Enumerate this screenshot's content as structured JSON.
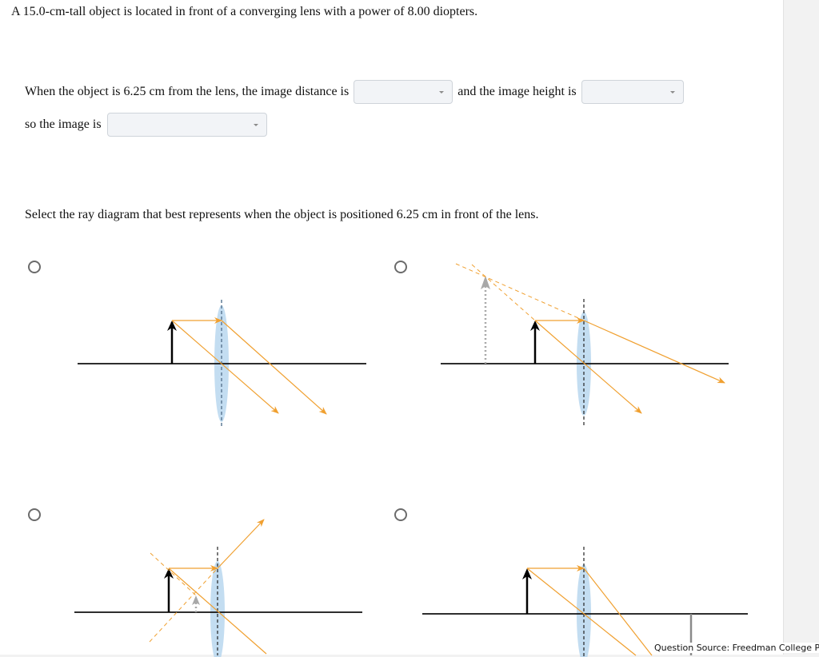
{
  "question": {
    "intro": "A 15.0-cm-tall object is located in front of a converging lens with a power of 8.00 diopters.",
    "line1_prefix": "When the object is 6.25 cm from the lens, the image distance is",
    "line1_middle": "and the image height is",
    "line2_prefix": "so the image is",
    "dropdowns": {
      "image_distance": {
        "selected": ""
      },
      "image_height": {
        "selected": ""
      },
      "image_type": {
        "selected": ""
      }
    },
    "prompt": "Select the ray diagram that best represents when the object is positioned 6.25 cm in front of the lens."
  },
  "options": [
    {
      "id": "A",
      "description": "Rays diverge after lens, no image formed (parallel refracted rays)",
      "selected": false
    },
    {
      "id": "B",
      "description": "Virtual upright enlarged image on same side as object (dashed extensions, gray dotted image arrow)",
      "selected": false
    },
    {
      "id": "C",
      "description": "Small virtual upright image between object and lens",
      "selected": false
    },
    {
      "id": "D",
      "description": "Real inverted image on far side of lens",
      "selected": false
    }
  ],
  "footer": {
    "source": "Question Source: Freedman College Phys"
  },
  "colors": {
    "ray": "#f0a030",
    "lens": "#b9d7ee",
    "axis": "#111111",
    "virtual_image": "#a8a8a8"
  }
}
